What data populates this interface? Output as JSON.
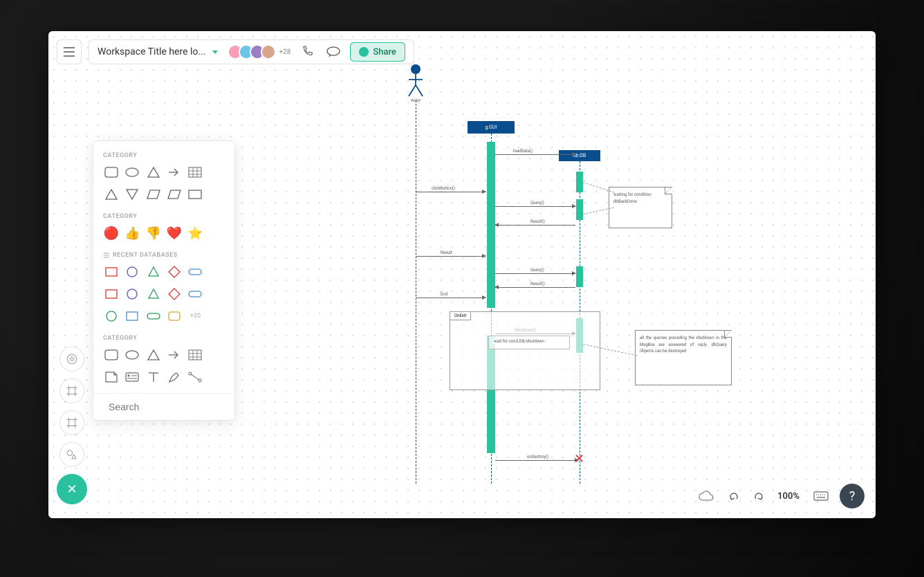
{
  "header": {
    "workspace_title": "Workspace Title here lo...",
    "avatar_overflow": "+28",
    "share_label": "Share"
  },
  "shapes_panel": {
    "section1_label": "CATEGORY",
    "section2_label": "CATEGORY",
    "section3_label": "RECENT DATABASES",
    "section4_label": "CATEGORY",
    "more_shapes": "+20",
    "search_placeholder": "Search",
    "emojis": [
      "🔴",
      "👍",
      "👎",
      "❤️",
      "⭐"
    ]
  },
  "bottom_bar": {
    "zoom": "100%"
  },
  "diagram": {
    "actor_label": "Actor",
    "box1_label": "g:GUI",
    "box2_label": "db:DB",
    "messages": {
      "m1": "clickButton()",
      "m2": "loadData()",
      "m3": "Query()",
      "m4": "Result()",
      "m5": "Result",
      "m6": "Query()",
      "m7": "Result()",
      "m8": "End",
      "m9": "Shutdown()",
      "m10": "wait for cond.DB/shutdown",
      "m11": "onDestroy()"
    },
    "note1": "waiting for condition dbBackDone",
    "note2": "all the queries preceding the shutdown in the MsgBox are answered of reply. dbQuery Objects can be destroyed",
    "frag_label": "OnExit"
  }
}
